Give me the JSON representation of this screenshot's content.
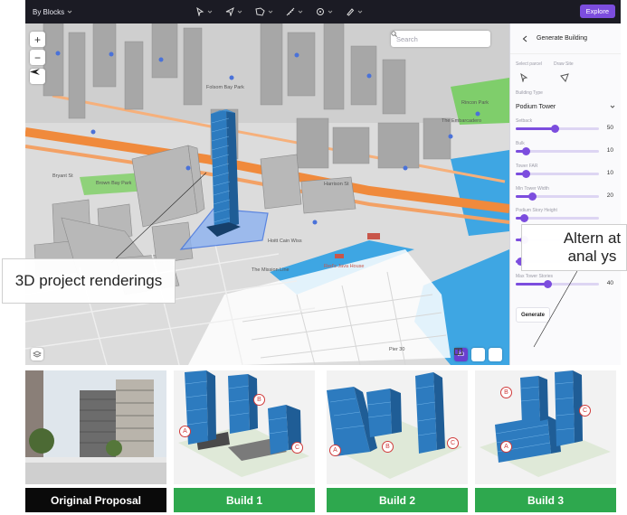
{
  "toolbar": {
    "mode_label": "By Blocks",
    "explore_label": "Explore"
  },
  "map": {
    "search_placeholder": "Search",
    "zoom_in": "+",
    "zoom_out": "−",
    "view_3d": "3D",
    "place_labels": [
      "Bryant St",
      "Brown Bay Park",
      "Folsom Bay Park",
      "Harrison St",
      "Rincon Park",
      "The Embarcadero",
      "Hoitt Cain Wiss",
      "The Mission Line",
      "Red's Java House",
      "Pier 30"
    ]
  },
  "panel": {
    "title": "Generate Building",
    "select_parcel": "Select parcel",
    "draw_site": "Draw Site",
    "building_type_label": "Building Type",
    "building_type_value": "Podium Tower",
    "sliders": [
      {
        "label": "Setback",
        "value": "50",
        "fraction": 0.47
      },
      {
        "label": "Bulk",
        "value": "10",
        "fraction": 0.12
      },
      {
        "label": "Tower FAR",
        "value": "10",
        "fraction": 0.12
      },
      {
        "label": "Min Tower Width",
        "value": "20",
        "fraction": 0.2
      },
      {
        "label": "Podium Story Height",
        "value": "",
        "fraction": 0.1
      },
      {
        "label": "",
        "value": "",
        "fraction": 0.1
      },
      {
        "label": "",
        "value": "2",
        "fraction": 0.05
      },
      {
        "label": "Max Tower Stories",
        "value": "40",
        "fraction": 0.38
      }
    ],
    "generate_label": "Generate"
  },
  "callouts": {
    "left": "3D project renderings",
    "right": "Altern at anal ys"
  },
  "cards": [
    {
      "label": "Original Proposal",
      "style": "black"
    },
    {
      "label": "Build 1",
      "style": "green"
    },
    {
      "label": "Build 2",
      "style": "green"
    },
    {
      "label": "Build 3",
      "style": "green"
    }
  ],
  "building_markers": [
    "A",
    "B",
    "C"
  ],
  "colors": {
    "accent": "#7c4dde",
    "tower": "#2d7bbf",
    "highway": "#f08a3c",
    "water": "#3ea6e3",
    "park": "#7fce6b",
    "card_green": "#2ea84e"
  }
}
